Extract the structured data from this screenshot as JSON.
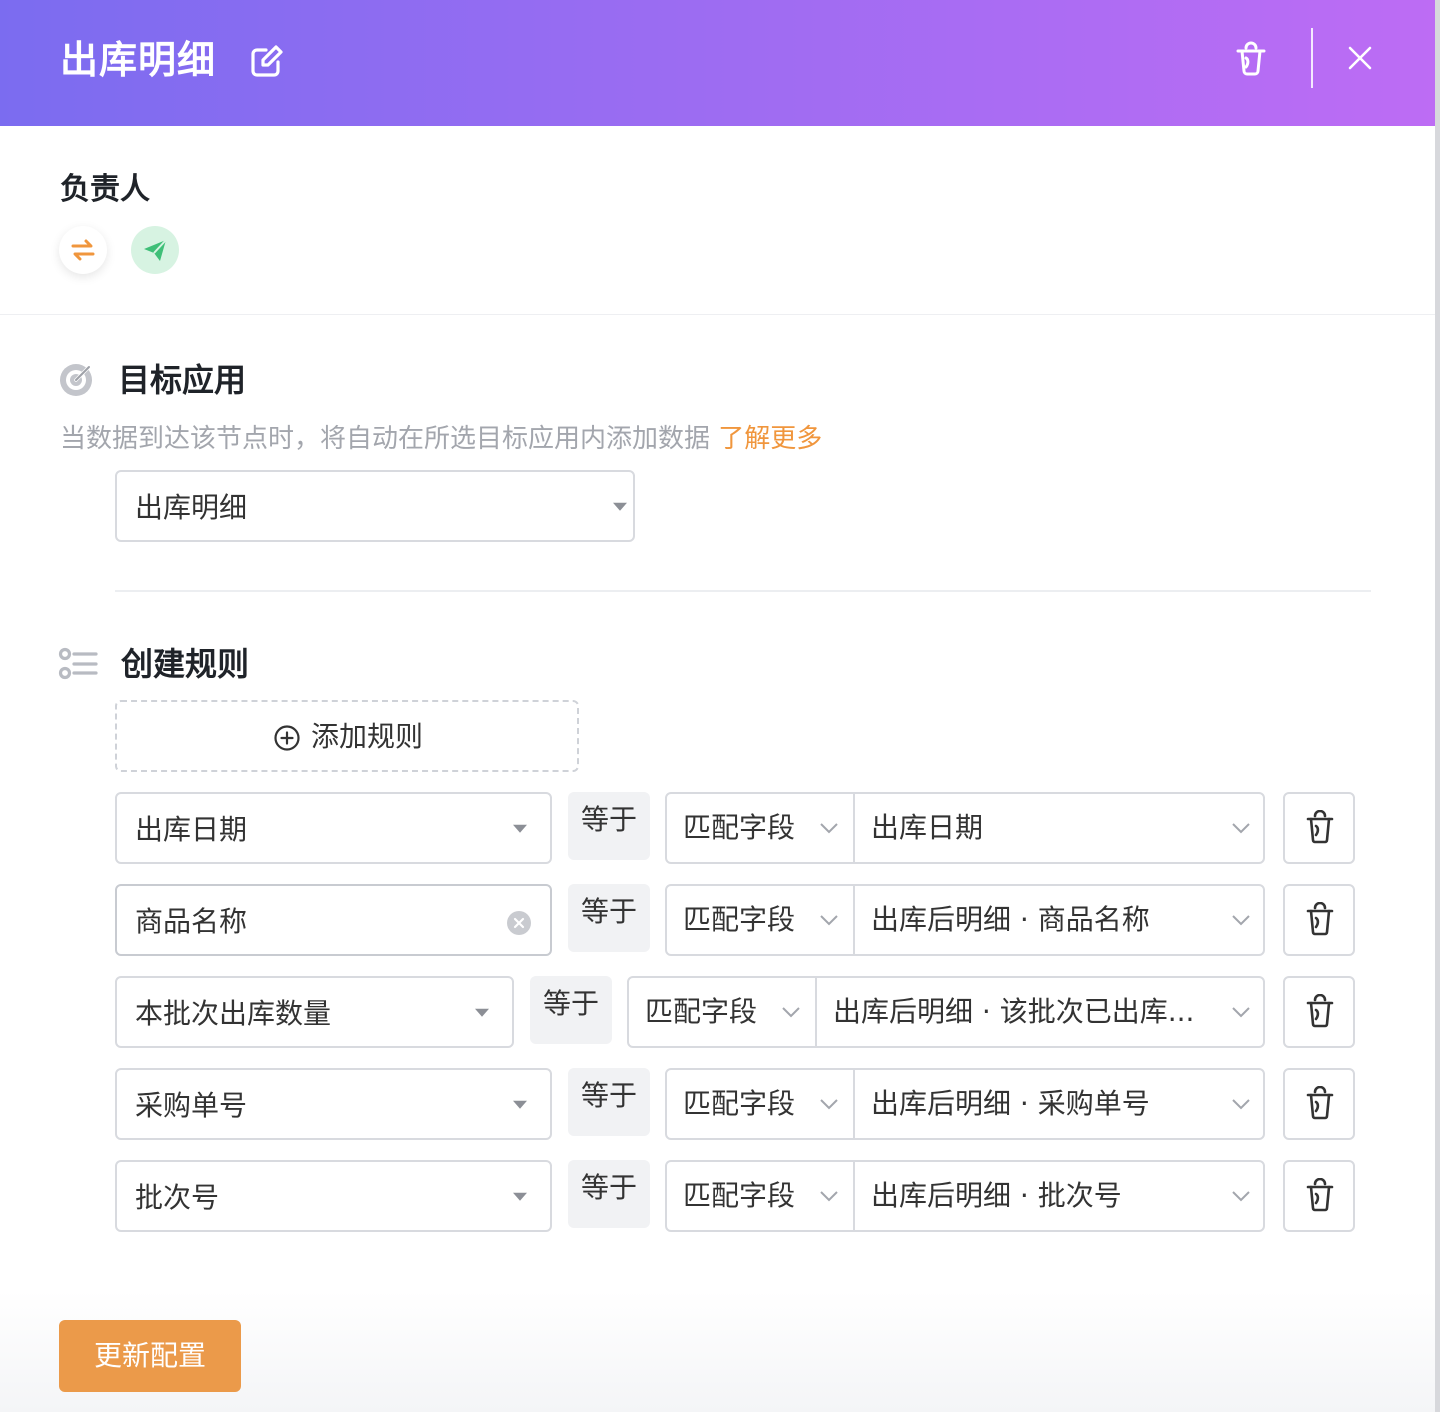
{
  "header": {
    "title": "出库明细"
  },
  "owner": {
    "title": "负责人"
  },
  "target_app": {
    "title": "目标应用",
    "description": "当数据到达该节点时，将自动在所选目标应用内添加数据",
    "learn_more": "了解更多",
    "selected_app": "出库明细"
  },
  "create_rules": {
    "title": "创建规则",
    "add_rule_label": "添加规则",
    "rules": [
      {
        "field": "出库日期",
        "operator": "等于",
        "match_type": "匹配字段",
        "match_field": "出库日期"
      },
      {
        "field": "商品名称",
        "operator": "等于",
        "match_type": "匹配字段",
        "match_field": "出库后明细 · 商品名称"
      },
      {
        "field": "本批次出库数量",
        "operator": "等于",
        "match_type": "匹配字段",
        "match_field": "出库后明细 · 该批次已出库..."
      },
      {
        "field": "采购单号",
        "operator": "等于",
        "match_type": "匹配字段",
        "match_field": "出库后明细 · 采购单号"
      },
      {
        "field": "批次号",
        "operator": "等于",
        "match_type": "匹配字段",
        "match_field": "出库后明细 · 批次号"
      }
    ]
  },
  "footer": {
    "update_button": "更新配置"
  },
  "colors": {
    "header_gradient_start": "#7b6cf0",
    "header_gradient_end": "#bd6cf4",
    "accent_orange": "#eb9a4a",
    "link_orange": "#f0963d",
    "send_green": "#3fbf78"
  },
  "icons": [
    "edit-icon",
    "trash-icon",
    "close-icon",
    "swap-icon",
    "send-icon",
    "target-icon",
    "rules-list-icon",
    "plus-circle-icon",
    "chevron-down-icon",
    "clear-icon"
  ]
}
